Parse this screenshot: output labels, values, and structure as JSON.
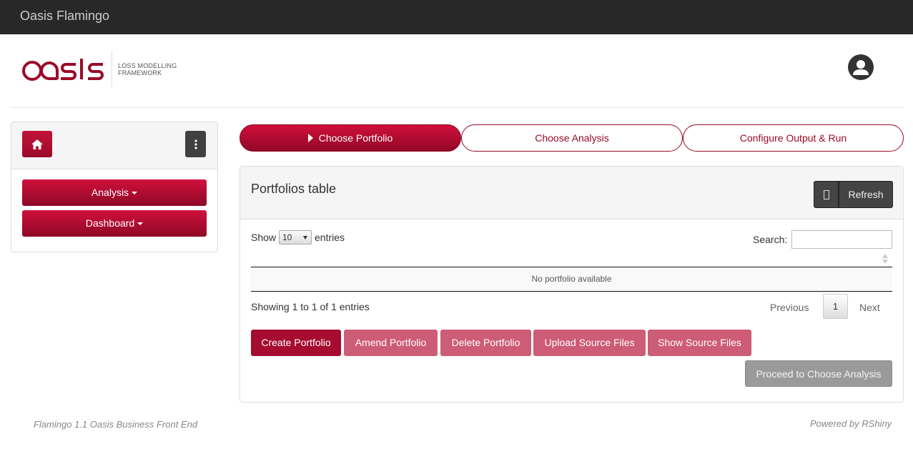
{
  "app": {
    "title": "Oasis Flamingo"
  },
  "logo": {
    "word": "oasis",
    "tagline_1": "LOSS MODELLING",
    "tagline_2": "FRAMEWORK"
  },
  "sidebar": {
    "analysis_label": "Analysis",
    "dashboard_label": "Dashboard"
  },
  "steps": [
    {
      "label": "Choose Portfolio",
      "active": true
    },
    {
      "label": "Choose Analysis",
      "active": false
    },
    {
      "label": "Configure Output & Run",
      "active": false
    }
  ],
  "panel": {
    "title": "Portfolios table",
    "refresh_label": "Refresh",
    "show_label": "Show",
    "page_length": "10",
    "entries_label": "entries",
    "search_label": "Search:",
    "search_value": "",
    "empty_message": "No portfolio available",
    "info": "Showing 1 to 1 of 1 entries",
    "pagination": {
      "previous": "Previous",
      "current": "1",
      "next": "Next"
    },
    "actions": {
      "create": "Create Portfolio",
      "amend": "Amend Portfolio",
      "delete": "Delete Portfolio",
      "upload": "Upload Source Files",
      "show": "Show Source Files",
      "proceed": "Proceed to Choose Analysis"
    }
  },
  "footer": {
    "left": "Flamingo 1.1 Oasis Business Front End",
    "right": "Powered by RShiny"
  },
  "colors": {
    "brand": "#9b0a2a",
    "topbar": "#282828"
  }
}
